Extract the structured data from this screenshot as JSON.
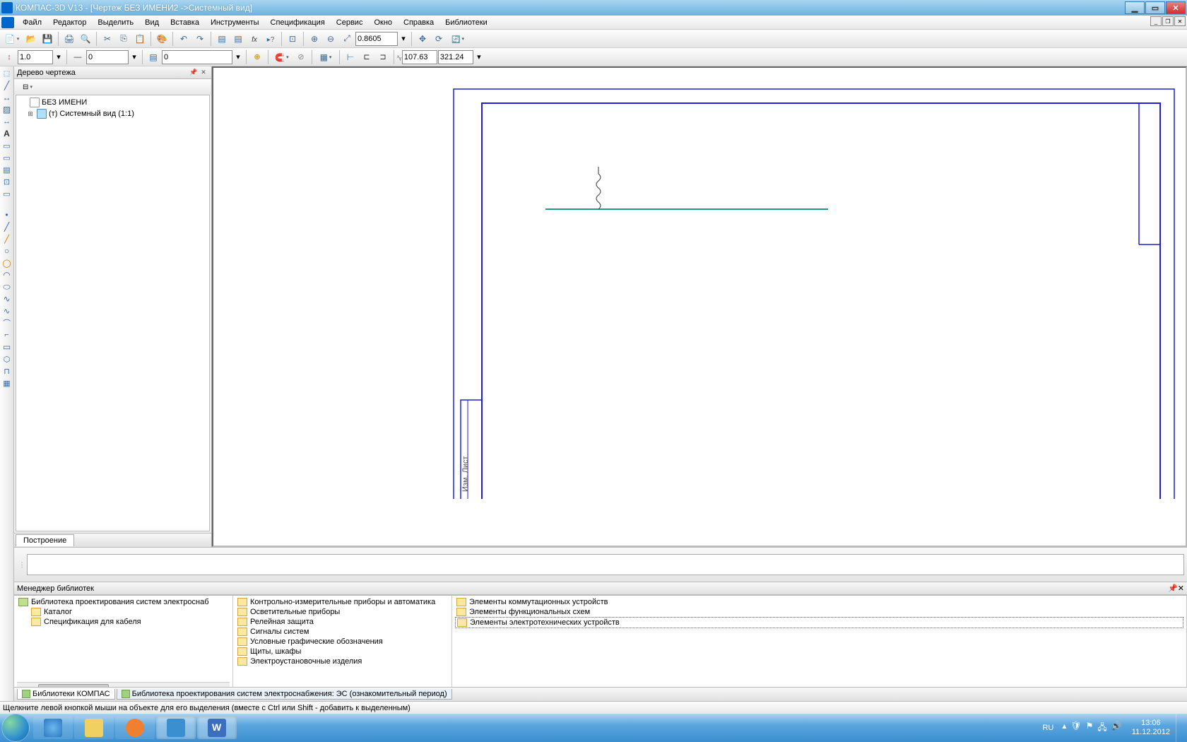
{
  "titlebar": {
    "text": "КОМПАС-3D V13 - [Чертеж БЕЗ ИМЕНИ2 ->Системный вид]"
  },
  "menu": {
    "items": [
      "Файл",
      "Редактор",
      "Выделить",
      "Вид",
      "Вставка",
      "Инструменты",
      "Спецификация",
      "Сервис",
      "Окно",
      "Справка",
      "Библиотеки"
    ]
  },
  "toolbar1": {
    "zoom_value": "0.8605"
  },
  "toolbar2": {
    "step": "1.0",
    "style": "0",
    "layer": "0",
    "coord_x": "107.63",
    "coord_y": "321.24"
  },
  "tree": {
    "title": "Дерево чертежа",
    "root": "БЕЗ ИМЕНИ",
    "view": "(т) Системный вид (1:1)",
    "bottom_tab": "Построение"
  },
  "libmgr": {
    "title": "Менеджер библиотек",
    "col1": {
      "root": "Библиотека проектирования систем электроснаб",
      "children": [
        "Каталог",
        "Спецификация для кабеля"
      ]
    },
    "col2": [
      "Контрольно-измерительные приборы и автоматика",
      "Осветительные приборы",
      "Релейная защита",
      "Сигналы систем",
      "Условные графические обозначения",
      "Щиты, шкафы",
      "Электроустановочные изделия"
    ],
    "col3": [
      "Элементы коммутационных устройств",
      "Элементы функциональных схем",
      "Элементы электротехнических устройств"
    ],
    "tabs": [
      "Библиотеки КОМПАС",
      "Библиотека проектирования систем электроснабжения: ЭС (ознакомительный период)"
    ]
  },
  "status": {
    "text": "Щелкните левой кнопкой мыши на объекте для его выделения (вместе с Ctrl или Shift - добавить к выделенным)"
  },
  "taskbar": {
    "lang": "RU",
    "time": "13:06",
    "date": "11.12.2012"
  }
}
